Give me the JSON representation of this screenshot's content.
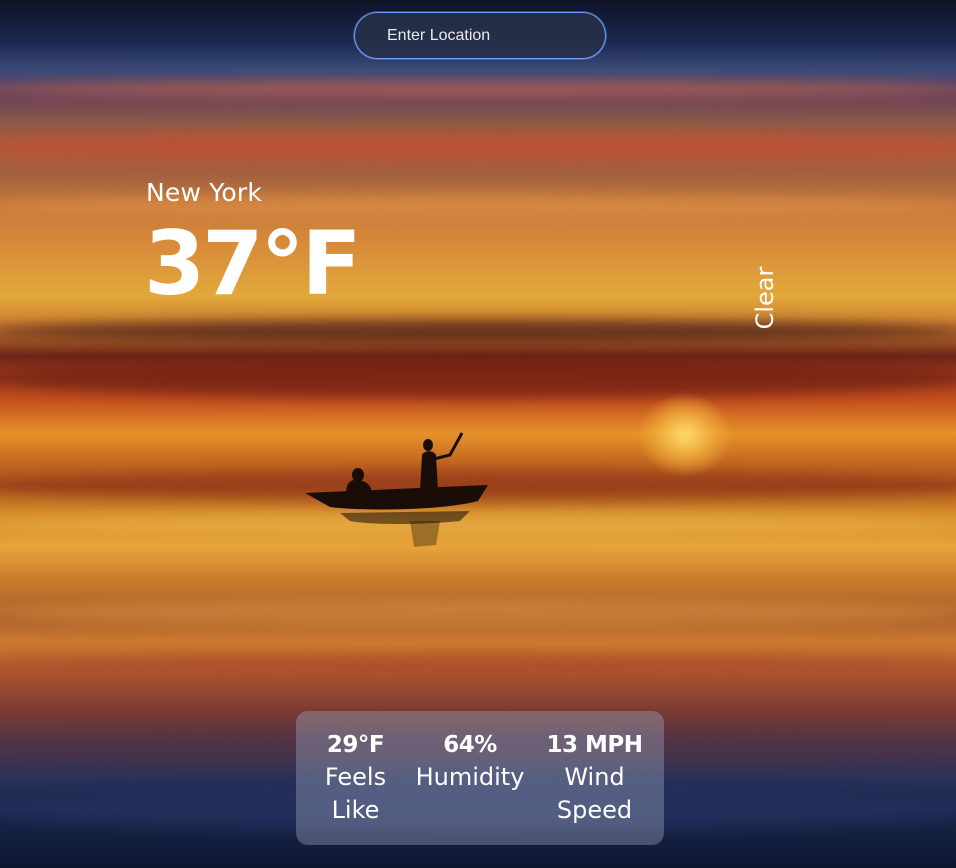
{
  "search": {
    "placeholder": "Enter Location",
    "value": ""
  },
  "weather": {
    "city": "New York",
    "temperature": "37°F",
    "condition": "Clear"
  },
  "stats": {
    "feels_like": {
      "value": "29°F",
      "label_line1": "Feels",
      "label_line2": "Like"
    },
    "humidity": {
      "value": "64%",
      "label_line1": "Humidity",
      "label_line2": ""
    },
    "wind": {
      "value": "13 MPH",
      "label_line1": "Wind",
      "label_line2": "Speed"
    }
  },
  "colors": {
    "text": "#ffffff",
    "search_border": "#6fa0ff",
    "panel_background": "rgba(150,160,185,0.42)"
  },
  "background": {
    "icon": "sunset-boat-image"
  }
}
